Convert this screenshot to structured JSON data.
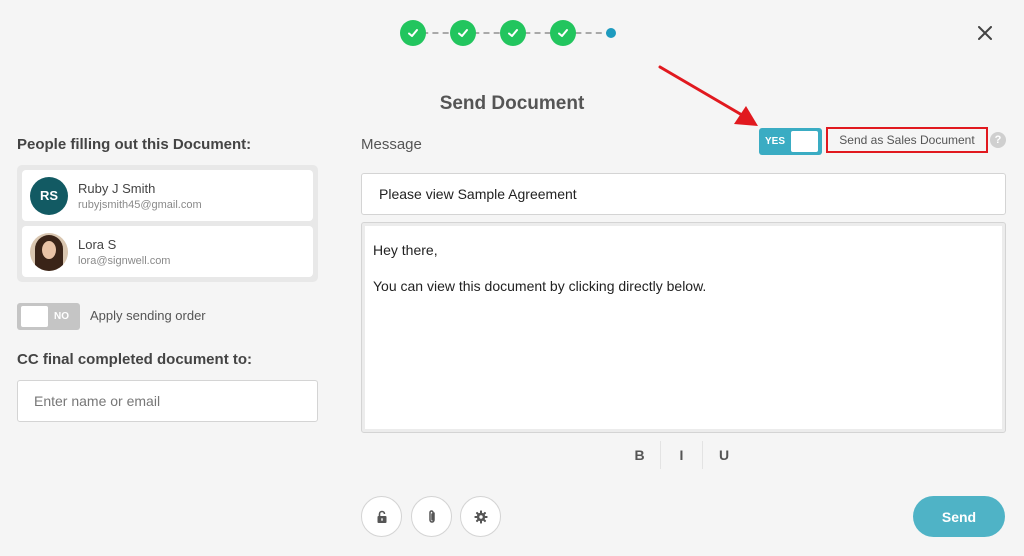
{
  "stepper": {
    "completed_steps": 4,
    "total_steps": 5
  },
  "title": "Send Document",
  "left": {
    "people_label": "People filling out this Document:",
    "people": [
      {
        "initials": "RS",
        "name": "Ruby J Smith",
        "email": "rubyjsmith45@gmail.com"
      },
      {
        "initials": "",
        "name": "Lora S",
        "email": "lora@signwell.com"
      }
    ],
    "sending_order_toggle": "NO",
    "sending_order_label": "Apply sending order",
    "cc_label": "CC final completed document to:",
    "cc_placeholder": "Enter name or email"
  },
  "right": {
    "message_label": "Message",
    "sales_toggle": "YES",
    "sales_label": "Send as Sales Document",
    "help_glyph": "?",
    "subject": "Please view Sample Agreement",
    "body_line1": "Hey there,",
    "body_line2": "You can view this document by clicking directly below.",
    "format": {
      "bold": "B",
      "italic": "I",
      "underline": "U"
    },
    "send_label": "Send"
  },
  "colors": {
    "step_done": "#22c55e",
    "step_current": "#1e9bbf",
    "toggle_on": "#3aacc3",
    "send_button": "#4fb3c6",
    "annotation_red": "#e1191f"
  },
  "icons": [
    "check-icon",
    "close-icon",
    "help-icon",
    "lock-icon",
    "paperclip-icon",
    "gear-icon",
    "arrow-annotation"
  ]
}
